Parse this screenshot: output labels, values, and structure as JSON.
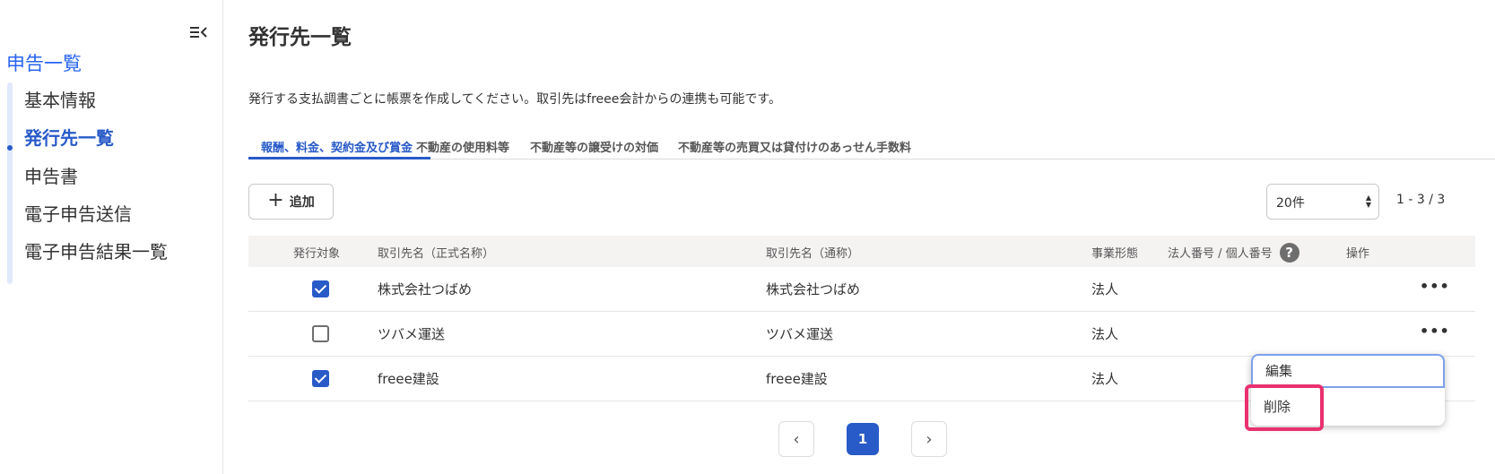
{
  "sidebar": {
    "parent": "申告一覧",
    "items": [
      {
        "label": "基本情報"
      },
      {
        "label": "発行先一覧"
      },
      {
        "label": "申告書"
      },
      {
        "label": "電子申告送信"
      },
      {
        "label": "電子申告結果一覧"
      }
    ],
    "active_index": 1
  },
  "main": {
    "title": "発行先一覧",
    "description": "発行する支払調書ごとに帳票を作成してください。取引先はfreee会計からの連携も可能です。",
    "tabs": [
      {
        "label": "報酬、料金、契約金及び賞金"
      },
      {
        "label": "不動産の使用料等"
      },
      {
        "label": "不動産等の譲受けの対価"
      },
      {
        "label": "不動産等の売買又は貸付けのあっせん手数料"
      }
    ],
    "active_tab": 0,
    "add_button": "追加",
    "per_page": "20件",
    "range": "1 - 3 / 3"
  },
  "table": {
    "headers": {
      "target": "発行対象",
      "official_name": "取引先名（正式名称）",
      "common_name": "取引先名（通称）",
      "business_type": "事業形態",
      "number": "法人番号 / 個人番号",
      "actions": "操作"
    },
    "rows": [
      {
        "checked": true,
        "official_name": "株式会社つばめ",
        "common_name": "株式会社つばめ",
        "business_type": "法人"
      },
      {
        "checked": false,
        "official_name": "ツバメ運送",
        "common_name": "ツバメ運送",
        "business_type": "法人"
      },
      {
        "checked": true,
        "official_name": "freee建設",
        "common_name": "freee建設",
        "business_type": "法人"
      }
    ]
  },
  "pagination": {
    "current": "1",
    "prev": "‹",
    "next": "›"
  },
  "context_menu": {
    "edit": "編集",
    "delete": "削除"
  },
  "icons": {
    "help": "?",
    "more": "•••",
    "plus": "+"
  },
  "colors": {
    "accent": "#285ac8",
    "highlight": "#e8316f"
  }
}
